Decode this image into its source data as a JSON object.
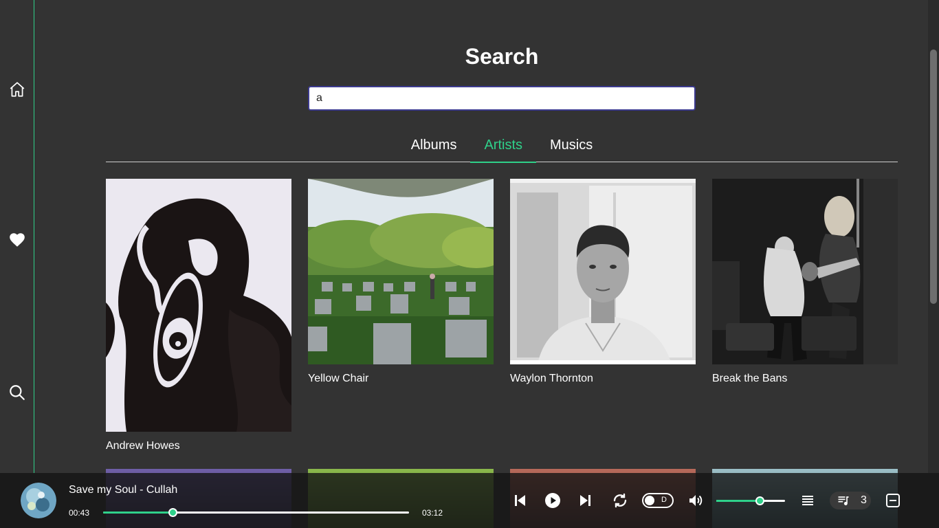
{
  "page": {
    "title": "Search"
  },
  "search": {
    "value": "a"
  },
  "tabs": [
    {
      "label": "Albums",
      "active": false
    },
    {
      "label": "Artists",
      "active": true
    },
    {
      "label": "Musics",
      "active": false
    }
  ],
  "artists": [
    {
      "name": "Andrew Howes"
    },
    {
      "name": "Yellow Chair"
    },
    {
      "name": "Waylon Thornton"
    },
    {
      "name": "Break the Bans"
    }
  ],
  "player": {
    "track": "Save my Soul - Cullah",
    "elapsed": "00:43",
    "duration": "03:12",
    "progress_fraction": 0.226,
    "toggle_label": "D",
    "volume_fraction": 0.63,
    "queue_count": "3"
  },
  "colors": {
    "accent": "#2fd18a",
    "background": "#333333",
    "player": "#141414"
  },
  "icons": {
    "sidebar": [
      "home-icon",
      "heart-icon",
      "search-icon"
    ],
    "player": [
      "skip-previous-icon",
      "play-icon",
      "skip-next-icon",
      "repeat-icon",
      "volume-icon",
      "list-icon",
      "queue-music-icon",
      "minimize-icon"
    ]
  }
}
